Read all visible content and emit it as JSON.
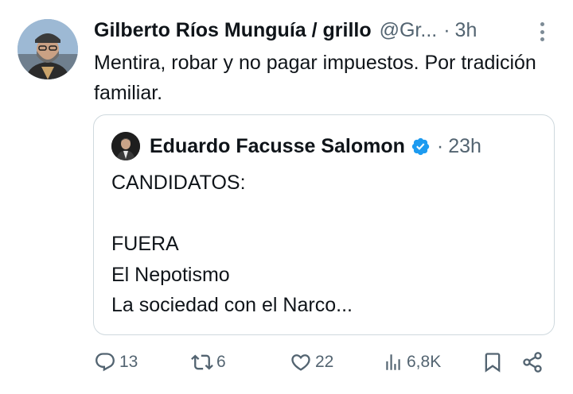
{
  "tweet": {
    "author_name": "Gilberto Ríos Munguía / grillo",
    "author_handle": "@Gr...",
    "separator": "·",
    "time": "3h",
    "text": "Mentira, robar y no pagar impuestos. Por tradición familiar."
  },
  "quoted": {
    "author_name": "Eduardo Facusse Salomon",
    "verified": true,
    "separator": "·",
    "time": "23h",
    "lines": [
      "CANDIDATOS:",
      "",
      "FUERA",
      "El Nepotismo",
      "La sociedad con el Narco..."
    ]
  },
  "actions": {
    "replies": "13",
    "retweets": "6",
    "likes": "22",
    "views": "6,8K"
  },
  "colors": {
    "text": "#0f1419",
    "muted": "#536471",
    "border": "#cfd9de",
    "verified": "#1d9bf0"
  },
  "icons": [
    "reply-icon",
    "retweet-icon",
    "like-icon",
    "views-icon",
    "bookmark-icon",
    "share-icon",
    "more-icon",
    "verified-badge-icon"
  ]
}
